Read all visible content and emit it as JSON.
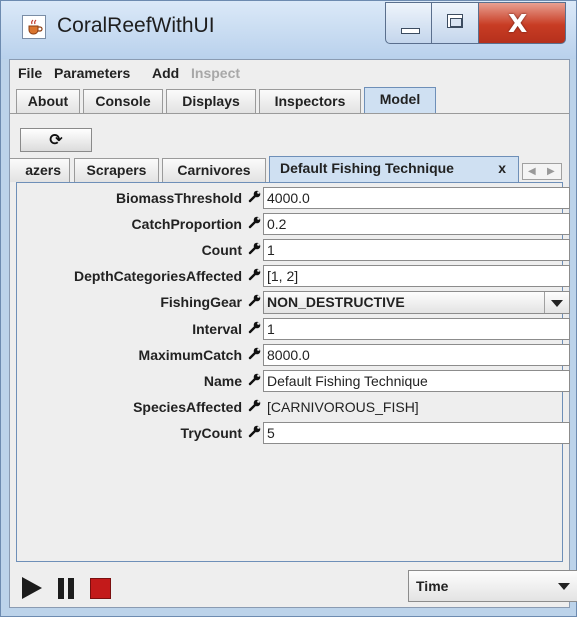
{
  "window": {
    "title": "CoralReefWithUI",
    "app_icon": "java-cup-icon",
    "controls": {
      "minimize": "minimize-icon",
      "maximize": "maximize-icon",
      "close": "X"
    }
  },
  "menubar": {
    "items": [
      {
        "label": "File",
        "enabled": true
      },
      {
        "label": "Parameters",
        "enabled": true
      },
      {
        "label": "Add",
        "enabled": true
      },
      {
        "label": "Inspect",
        "enabled": false
      }
    ]
  },
  "main_tabs": {
    "items": [
      {
        "label": "About"
      },
      {
        "label": "Console"
      },
      {
        "label": "Displays"
      },
      {
        "label": "Inspectors"
      },
      {
        "label": "Model"
      }
    ],
    "selected": "Model"
  },
  "refresh_button": {
    "glyph": "⟳",
    "icon": "refresh-icon"
  },
  "model_tabs": {
    "items": [
      {
        "label": "azers"
      },
      {
        "label": "Scrapers"
      },
      {
        "label": "Carnivores"
      },
      {
        "label": "Default Fishing Technique",
        "close": "x"
      }
    ],
    "selected": "Default Fishing Technique",
    "scroll_left": "◀",
    "scroll_right": "▶"
  },
  "properties": [
    {
      "label": "BiomassThreshold",
      "value": "4000.0",
      "kind": "field"
    },
    {
      "label": "CatchProportion",
      "value": "0.2",
      "kind": "field"
    },
    {
      "label": "Count",
      "value": "1",
      "kind": "field"
    },
    {
      "label": "DepthCategoriesAffected",
      "value": "[1, 2]",
      "kind": "field"
    },
    {
      "label": "FishingGear",
      "value": "NON_DESTRUCTIVE",
      "kind": "select"
    },
    {
      "label": "Interval",
      "value": "1",
      "kind": "field"
    },
    {
      "label": "MaximumCatch",
      "value": "8000.0",
      "kind": "field"
    },
    {
      "label": "Name",
      "value": "Default Fishing Technique",
      "kind": "field"
    },
    {
      "label": "SpeciesAffected",
      "value": "[CARNIVOROUS_FISH]",
      "kind": "readonly"
    },
    {
      "label": "TryCount",
      "value": "5",
      "kind": "field"
    }
  ],
  "controls": {
    "play_icon": "play-icon",
    "pause_icon": "pause-icon",
    "stop_icon": "stop-icon",
    "time_select": "Time"
  },
  "colors": {
    "titlebar": "#bcd3ea",
    "selected_tab": "#cfe0f2",
    "stop_red": "#c31a1a",
    "close_red": "#c83c24"
  }
}
